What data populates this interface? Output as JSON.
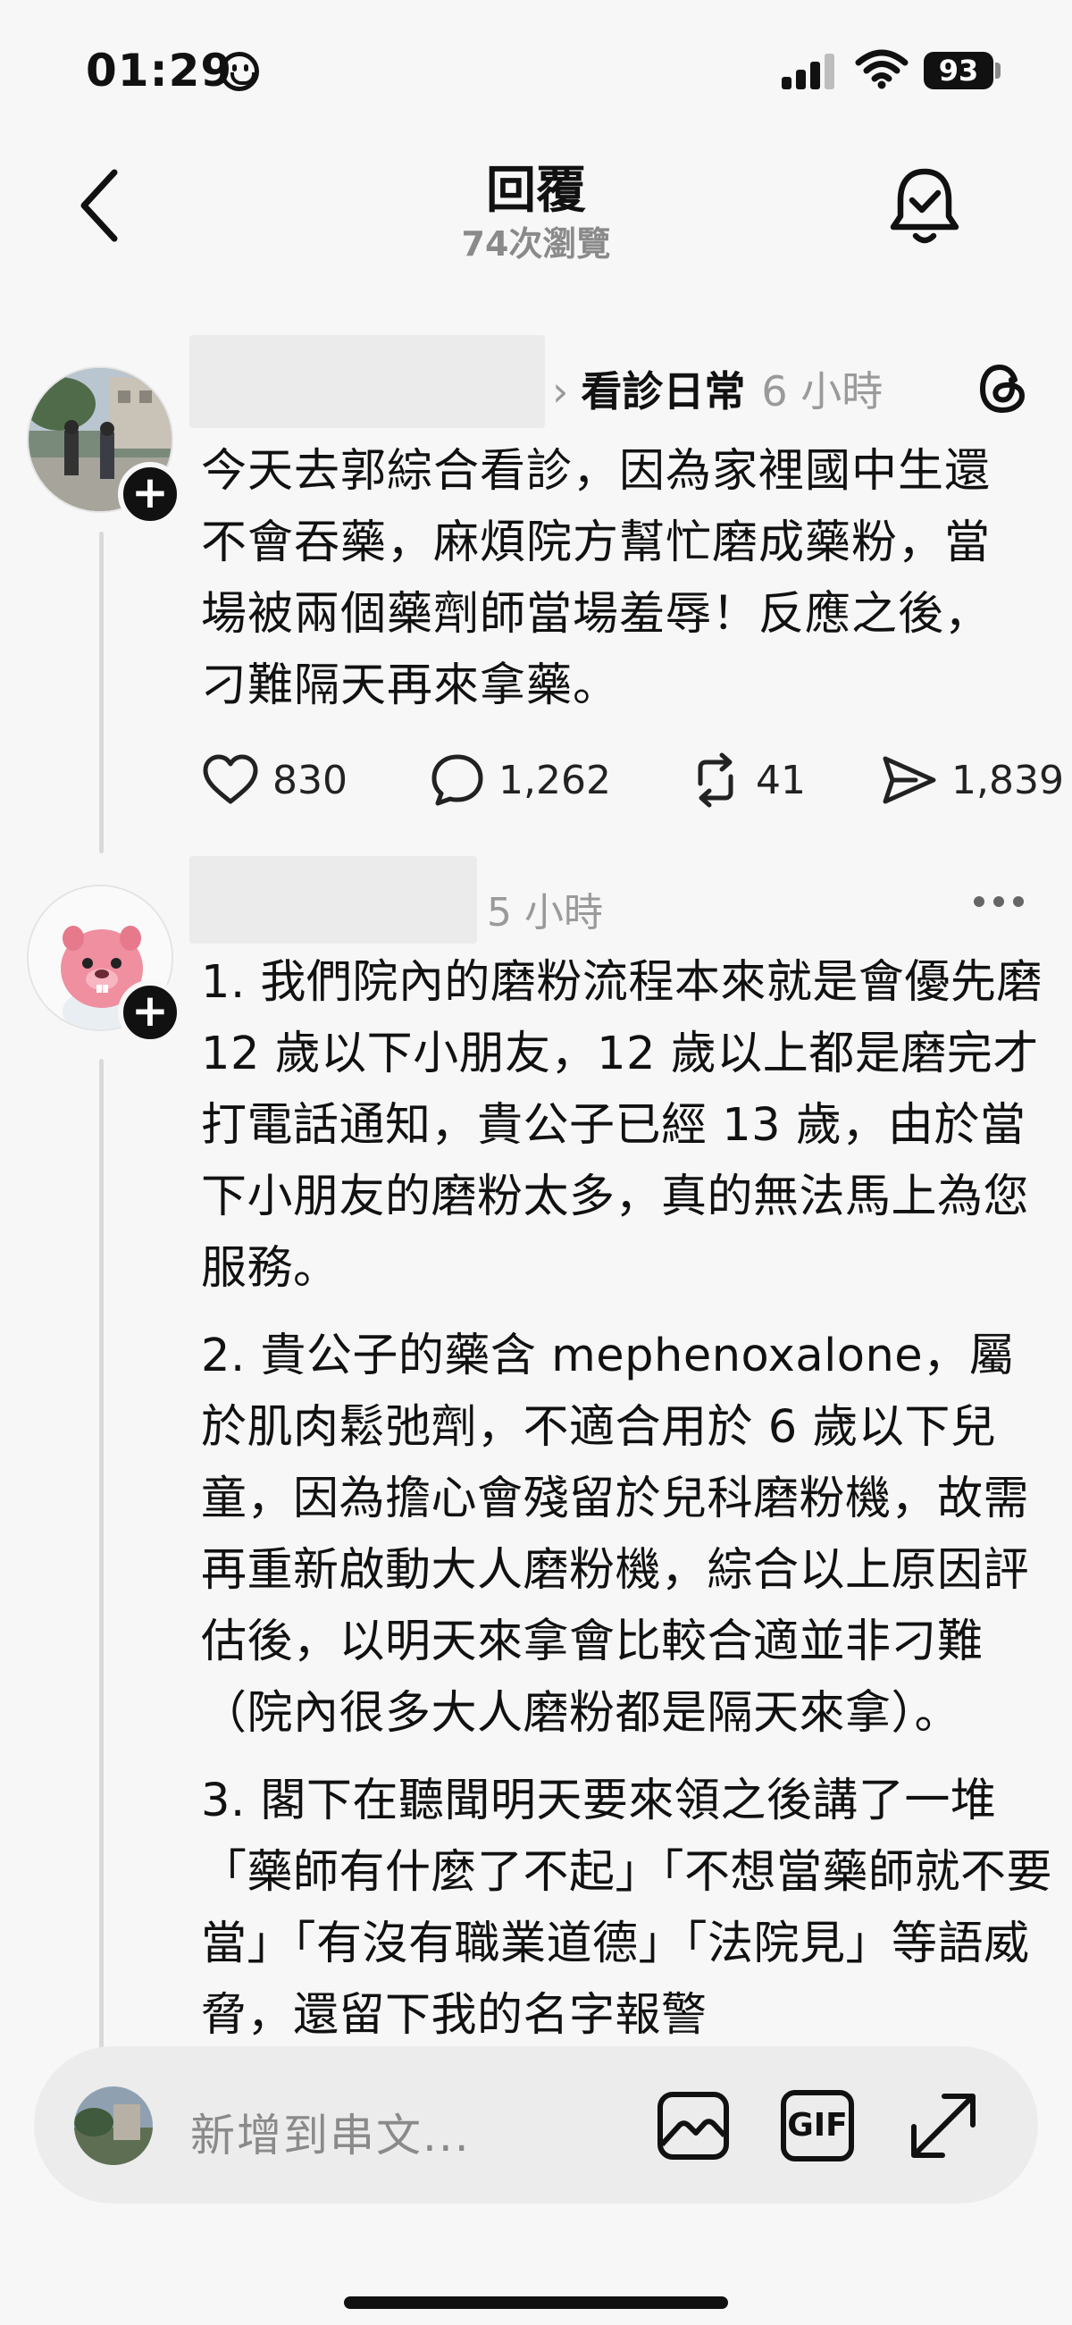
{
  "status_bar": {
    "time": "01:29",
    "battery": "93"
  },
  "header": {
    "title": "回覆",
    "views": "74次瀏覽"
  },
  "post": {
    "topic": "看診日常",
    "time": "6 小時",
    "text": "今天去郭綜合看診，因為家裡國中生還不會吞藥，麻煩院方幫忙磨成藥粉，當場被兩個藥劑師當場羞辱！反應之後，刁難隔天再來拿藥。",
    "likes": "830",
    "comments": "1,262",
    "reposts": "41",
    "shares": "1,839"
  },
  "reply": {
    "time": "5 小時",
    "paragraphs": [
      "1. 我們院內的磨粉流程本來就是會優先磨 12 歲以下小朋友，12 歲以上都是磨完才打電話通知，貴公子已經 13 歲，由於當下小朋友的磨粉太多，真的無法馬上為您服務。",
      "2. 貴公子的藥含 mephenoxalone，屬於肌肉鬆弛劑，不適合用於 6 歲以下兒童，因為擔心會殘留於兒科磨粉機，故需再重新啟動大人磨粉機，綜合以上原因評估後，以明天來拿會比較合適並非刁難（院內很多大人磨粉都是隔天來拿）。",
      "3. 閣下在聽聞明天要來領之後講了一堆「藥師有什麼了不起」「不想當藥師就不要當」「有沒有職業道德」「法院見」等語威脅，還留下我的名字報警"
    ]
  },
  "composer": {
    "placeholder": "新增到串文..."
  },
  "icons": {
    "back": "chevron-left-icon",
    "bell": "bell-check-icon",
    "threads": "threads-logo-icon",
    "like": "heart-icon",
    "comment": "comment-icon",
    "repost": "repost-icon",
    "share": "send-icon",
    "more": "more-dots-icon",
    "image": "image-icon",
    "gif": "GIF",
    "expand": "expand-icon"
  }
}
